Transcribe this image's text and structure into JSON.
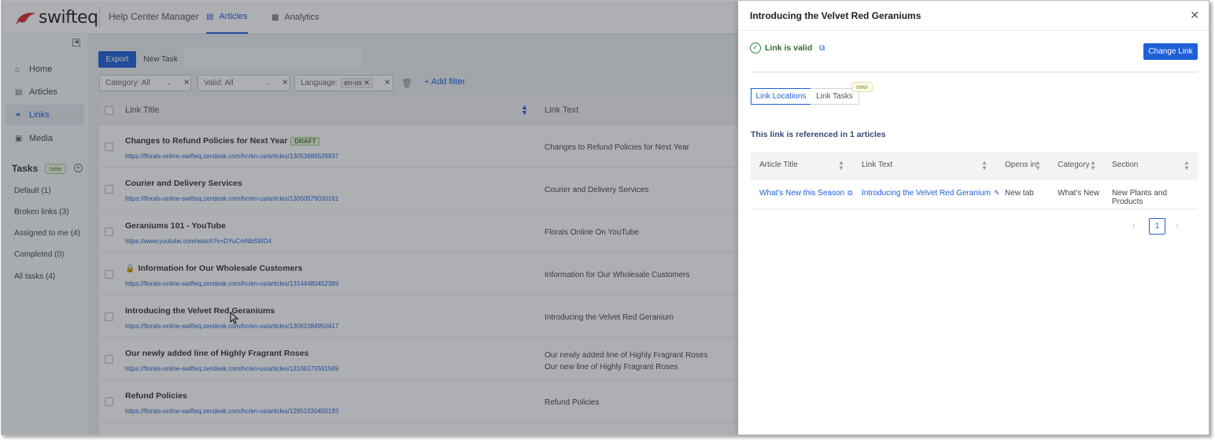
{
  "brand": {
    "name": "swifteq",
    "accent": "#1f5fd8",
    "logo_color": "#d42e2e"
  },
  "topbar": {
    "app_title": "Help Center Manager",
    "tabs": [
      {
        "label": "Articles",
        "icon": "book-icon",
        "active": true
      },
      {
        "label": "Analytics",
        "icon": "bar-chart-icon",
        "active": false
      }
    ]
  },
  "sidebar": {
    "items": [
      {
        "label": "Home",
        "icon": "home-icon"
      },
      {
        "label": "Articles",
        "icon": "book-icon"
      },
      {
        "label": "Links",
        "icon": "link-icon",
        "active": true
      },
      {
        "label": "Media",
        "icon": "image-icon"
      }
    ],
    "tasks_title": "Tasks",
    "tasks_badge": "new",
    "task_links": [
      "Default (1)",
      "Broken links (3)",
      "Assigned to me (4)",
      "Completed (0)",
      "All tasks (4)"
    ]
  },
  "toolbar": {
    "export_label": "Export",
    "new_task_label": "New Task"
  },
  "filters": {
    "category": "Category: All",
    "valid": "Valid: All",
    "language_label": "Language:",
    "language_value": "en-us",
    "add_filter": "+ Add filter"
  },
  "table": {
    "headers": {
      "link_title": "Link Title",
      "link_text": "Link Text"
    },
    "rows": [
      {
        "title": "Changes to Refund Policies for Next Year",
        "badge": "DRAFT",
        "url": "https://florals-online-swifteq.zendesk.com/hc/en-us/articles/13053686529937",
        "text": [
          "Changes to Refund Policies for Next Year"
        ]
      },
      {
        "title": "Courier and Delivery Services",
        "url": "https://florals-online-swifteq.zendesk.com/hc/en-us/articles/13050579030161",
        "text": [
          "Courier and Delivery Services"
        ]
      },
      {
        "title": "Geraniums 101 - YouTube",
        "url": "https://www.youtube.com/watch?v=DYuCmNbSWD4",
        "text": [
          "Florals Online On YouTube"
        ]
      },
      {
        "title": "Information for Our Wholesale Customers",
        "locked": true,
        "url": "https://florals-online-swifteq.zendesk.com/hc/en-us/articles/13144480452369",
        "text": [
          "Information for Our Wholesale Customers"
        ]
      },
      {
        "title": "Introducing the Velvet Red Geraniums",
        "url": "https://florals-online-swifteq.zendesk.com/hc/en-us/articles/13061084950417",
        "text": [
          "Introducing the Velvet Red Geranium"
        ]
      },
      {
        "title": "Our newly added line of Highly Fragrant Roses",
        "url": "https://florals-online-swifteq.zendesk.com/hc/en-us/articles/13106175591569",
        "text": [
          "Our newly added line of Highly Fragrant Roses",
          "Our new line of Highly Fragrant Roses"
        ]
      },
      {
        "title": "Refund Policies",
        "url": "https://florals-online-swifteq.zendesk.com/hc/en-us/articles/12951530450193",
        "text": [
          "Refund Policies"
        ]
      }
    ]
  },
  "panel": {
    "title": "Introducing the Velvet Red Geraniums",
    "status": "Link is valid",
    "change_link": "Change Link",
    "tabs": {
      "locations": "Link Locations",
      "tasks": "Link Tasks",
      "tasks_badge": "new"
    },
    "ref_text": "This link is referenced in 1 articles",
    "headers": {
      "article_title": "Article Title",
      "link_text": "Link Text",
      "opens_in": "Opens in",
      "category": "Category",
      "section": "Section"
    },
    "rows": [
      {
        "article_title": "What's New this Season",
        "link_text": "Introducing the Velvet Red Geranium",
        "opens_in": "New tab",
        "category": "What's New",
        "section": "New Plants and Products"
      }
    ],
    "pager": {
      "current": "1"
    }
  }
}
